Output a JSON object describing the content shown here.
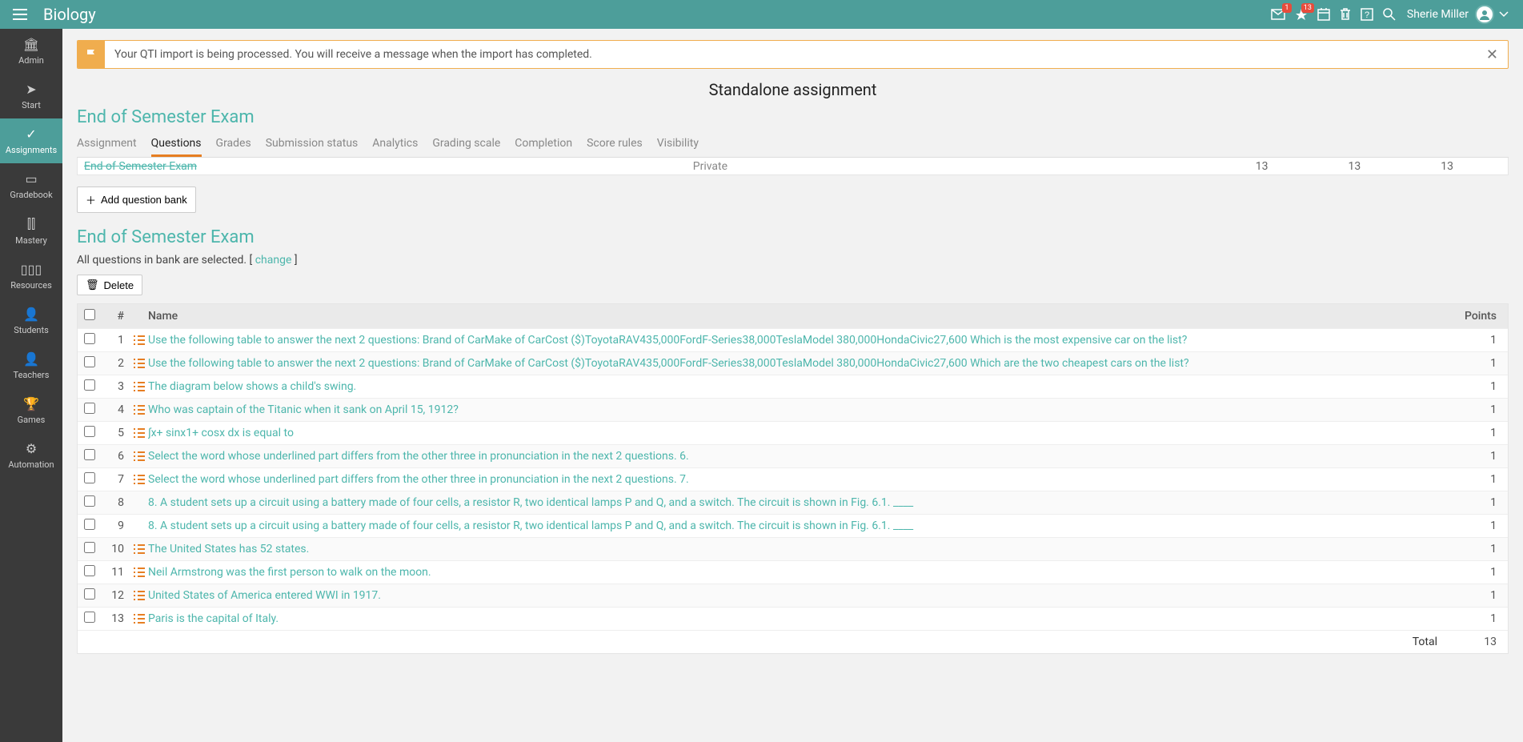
{
  "header": {
    "title": "Biology",
    "badges": {
      "inbox": "1",
      "bell": "13"
    },
    "user": "Sherie Miller"
  },
  "sidebar": {
    "items": [
      {
        "label": "Admin"
      },
      {
        "label": "Start"
      },
      {
        "label": "Assignments"
      },
      {
        "label": "Gradebook"
      },
      {
        "label": "Mastery"
      },
      {
        "label": "Resources"
      },
      {
        "label": "Students"
      },
      {
        "label": "Teachers"
      },
      {
        "label": "Games"
      },
      {
        "label": "Automation"
      }
    ]
  },
  "alert": {
    "text": "Your QTI import is being processed. You will receive a message when the import has completed."
  },
  "page_subtitle": "Standalone assignment",
  "section_title": "End of Semester Exam",
  "tabs": [
    {
      "label": "Assignment"
    },
    {
      "label": "Questions"
    },
    {
      "label": "Grades"
    },
    {
      "label": "Submission status"
    },
    {
      "label": "Analytics"
    },
    {
      "label": "Grading scale"
    },
    {
      "label": "Completion"
    },
    {
      "label": "Score rules"
    },
    {
      "label": "Visibility"
    }
  ],
  "bank_strip": {
    "name": "End of Semester Exam",
    "privacy": "Private",
    "n1": "13",
    "n2": "13",
    "n3": "13"
  },
  "add_bank_label": "Add question bank",
  "bank_title": "End of Semester Exam",
  "bank_subtext_prefix": "All questions in bank are selected. [ ",
  "bank_change": "change",
  "bank_subtext_suffix": " ]",
  "delete_label": "Delete",
  "table": {
    "head": {
      "num": "#",
      "name": "Name",
      "pts": "Points"
    },
    "rows": [
      {
        "n": "1",
        "t": "list",
        "name": "Use the following table to answer the next 2 questions: Brand of CarMake of CarCost ($)ToyotaRAV435,000FordF-Series38,000TeslaModel 380,000HondaCivic27,600   Which is the most expensive car on the list?",
        "pts": "1"
      },
      {
        "n": "2",
        "t": "list",
        "name": "Use the following table to answer the next 2 questions: Brand of CarMake of CarCost ($)ToyotaRAV435,000FordF-Series38,000TeslaModel 380,000HondaCivic27,600   Which are the two cheapest cars on the list?",
        "pts": "1"
      },
      {
        "n": "3",
        "t": "list",
        "name": "The diagram below shows a child's swing.",
        "pts": "1"
      },
      {
        "n": "4",
        "t": "list",
        "name": "Who was captain of the Titanic when it sank on April 15, 1912?",
        "pts": "1"
      },
      {
        "n": "5",
        "t": "list",
        "name": "∫x+   sinx1+   cosx   dx is equal to",
        "pts": "1"
      },
      {
        "n": "6",
        "t": "list",
        "name": "Select the word whose underlined part differs from the other three in pronunciation in the next 2 questions.    6.",
        "pts": "1"
      },
      {
        "n": "7",
        "t": "list",
        "name": "Select the word whose underlined part differs from the other three in pronunciation in the next 2 questions.    7.",
        "pts": "1"
      },
      {
        "n": "8",
        "t": "green",
        "name": "8. A student sets up a circuit using a battery made of four cells, a resistor R, two identical lamps P and Q, and a switch. The circuit is shown in Fig. 6.1. ____",
        "pts": "1"
      },
      {
        "n": "9",
        "t": "green",
        "name": "8. A student sets up a circuit using a battery made of four cells, a resistor R, two identical lamps P and Q, and a switch. The circuit is shown in Fig. 6.1. ____",
        "pts": "1"
      },
      {
        "n": "10",
        "t": "list",
        "name": "The United States has 52 states.",
        "pts": "1"
      },
      {
        "n": "11",
        "t": "list",
        "name": "Neil Armstrong was the first person to walk on the moon.",
        "pts": "1"
      },
      {
        "n": "12",
        "t": "list",
        "name": "United States of America entered WWI in 1917.",
        "pts": "1"
      },
      {
        "n": "13",
        "t": "list",
        "name": "Paris is the capital of Italy.",
        "pts": "1"
      }
    ],
    "total_label": "Total",
    "total": "13"
  }
}
